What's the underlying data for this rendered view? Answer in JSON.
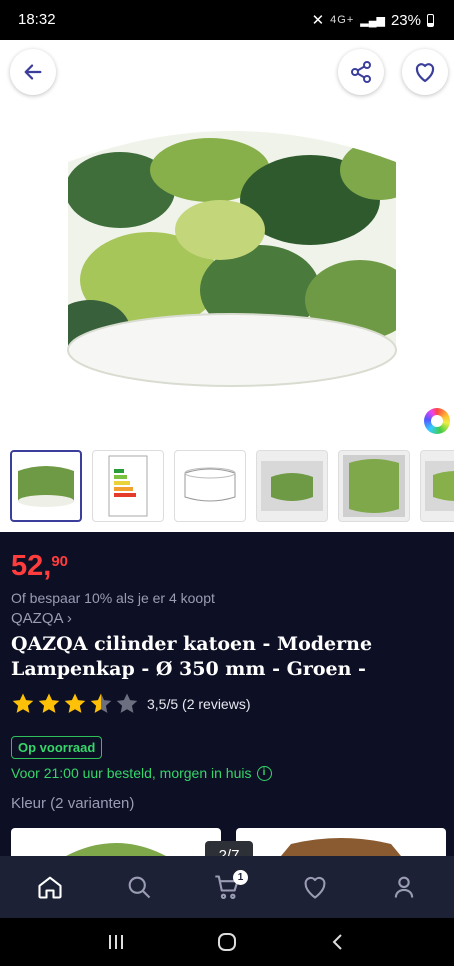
{
  "status_bar": {
    "time": "18:32",
    "signal": "4G+",
    "battery": "23%"
  },
  "gallery": {
    "counter": "2/7"
  },
  "product": {
    "price_main": "52,",
    "price_cents": "90",
    "offer": "Of bespaar 10% als je er 4 koopt",
    "brand": "QAZQA ›",
    "title": "QAZQA cilinder katoen - Moderne Lampenkap - Ø 350 mm - Groen -",
    "rating_value": 3.5,
    "rating_text": "3,5/5 (2 reviews)",
    "stock": "Op voorraad",
    "delivery": "Voor 21:00 uur besteld, morgen in huis",
    "color_label": "Kleur (2 varianten)"
  },
  "bottom_nav": {
    "cart_badge": "1"
  },
  "colors": {
    "price": "#ff3d3d",
    "stock_green": "#36d66a",
    "bg_dark": "#0d0f24",
    "nav_bg": "#1d2136",
    "accent_blue": "#3b3f9b"
  }
}
